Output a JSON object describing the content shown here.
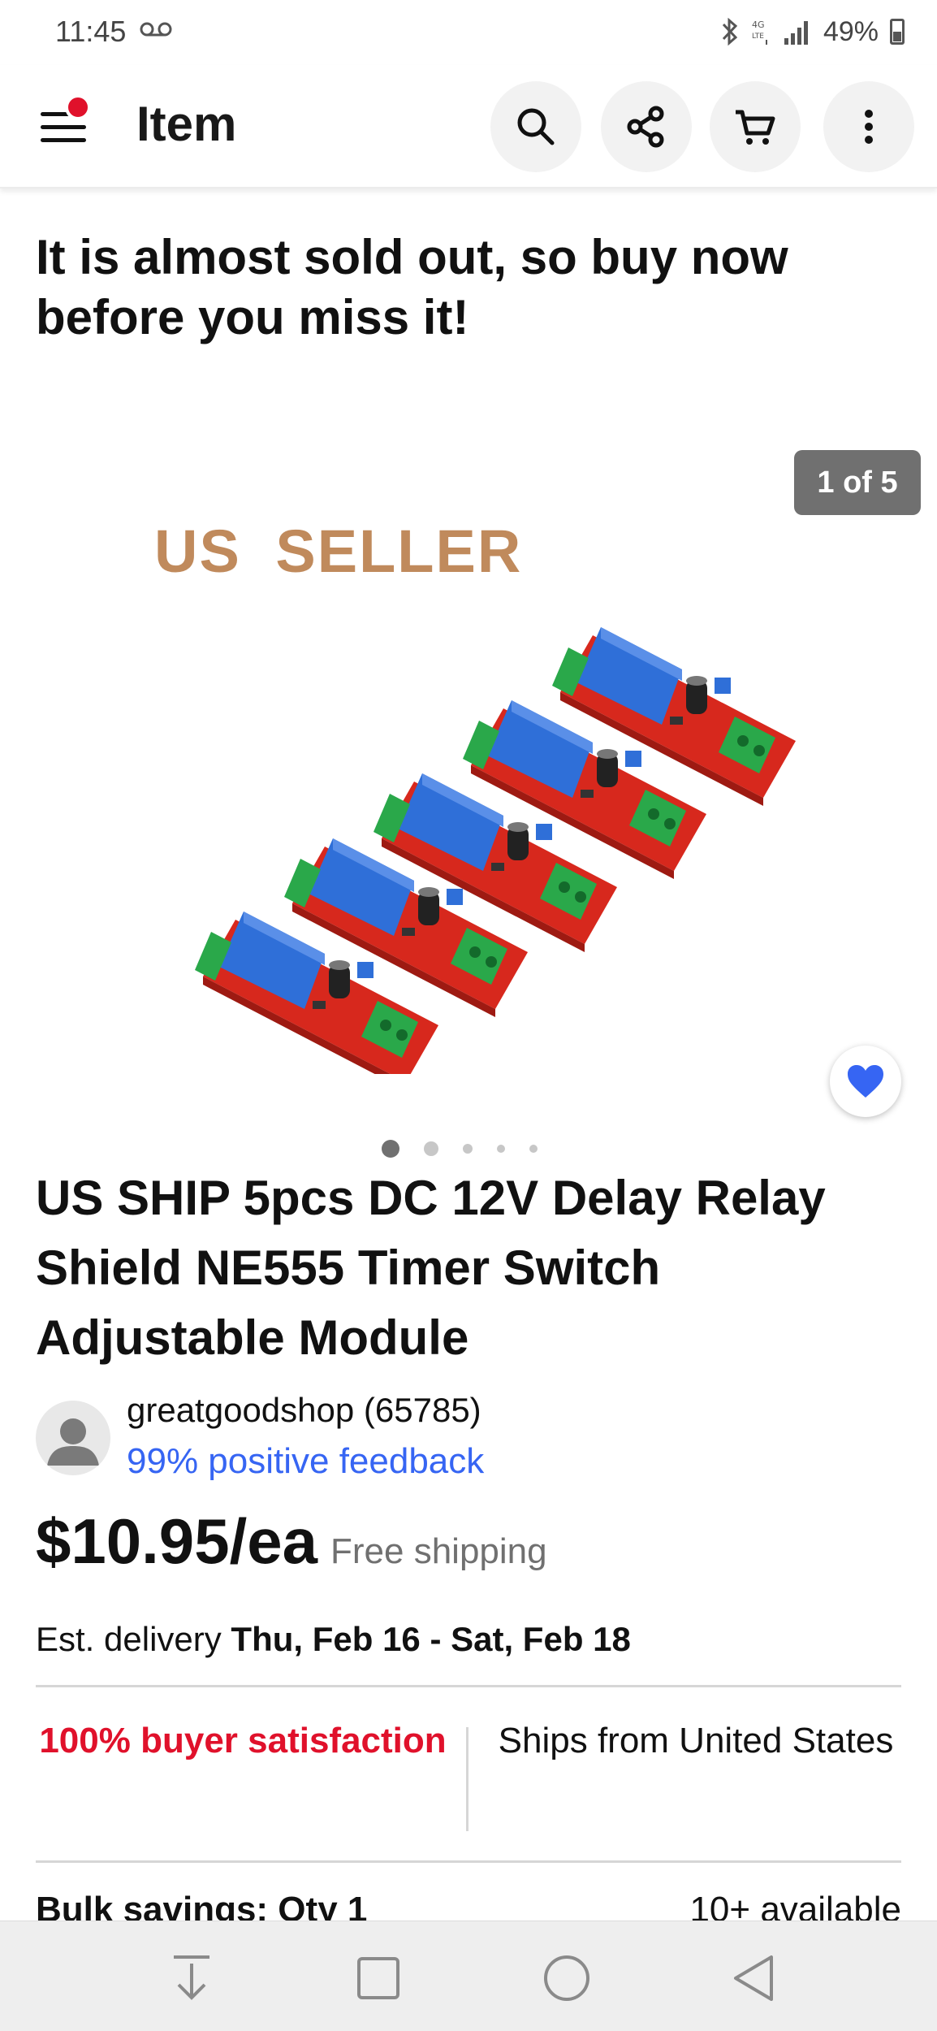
{
  "status_bar": {
    "time": "11:45",
    "battery": "49%"
  },
  "app_bar": {
    "title": "Item",
    "icons": [
      "menu-icon",
      "search-icon",
      "share-icon",
      "cart-icon",
      "more-vertical-icon"
    ],
    "notification_color": "#e0112b"
  },
  "promo_text": "It is almost sold out, so buy now before you miss it!",
  "gallery": {
    "counter": "1 of 5",
    "image_caption": "US  SELLER",
    "total_images": 5,
    "active_index": 1
  },
  "product": {
    "title": "US SHIP 5pcs DC 12V Delay Relay Shield NE555 Timer Switch Adjustable Module",
    "price": "$10.95/ea",
    "shipping": "Free shipping",
    "delivery_label": "Est. delivery",
    "delivery_dates": "Thu, Feb 16 - Sat, Feb 18"
  },
  "seller": {
    "name": "greatgoodshop (65785)",
    "feedback": "99% positive feedback"
  },
  "highlights": {
    "satisfaction": "100% buyer satisfaction",
    "ships_from": "Ships from United States"
  },
  "bulk": {
    "label": "Bulk savings: Qty 1",
    "available": "10+ available"
  },
  "colors": {
    "accent_red": "#e0112b",
    "link_blue": "#3665f3",
    "heart_blue": "#3665f3"
  }
}
